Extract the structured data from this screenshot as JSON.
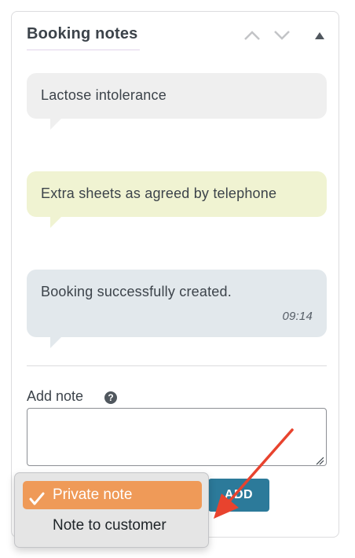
{
  "panel": {
    "title": "Booking notes",
    "header_buttons": [
      {
        "icon": "chevron-up-icon"
      },
      {
        "icon": "chevron-down-icon"
      },
      {
        "icon": "caret-up-icon"
      }
    ]
  },
  "notes": [
    {
      "text": "Lactose intolerance",
      "color": "#efefef"
    },
    {
      "text": "Extra sheets as agreed by telephone",
      "color": "#f0f3d2"
    },
    {
      "text": "Booking successfully created.",
      "time": "09:14",
      "color": "#e2e8ec"
    }
  ],
  "add_note": {
    "label": "Add note",
    "help_icon": "?",
    "input_value": "",
    "button_label": "ADD"
  },
  "note_type_menu": {
    "options": [
      {
        "label": "Private note",
        "selected": true
      },
      {
        "label": "Note to customer",
        "selected": false
      }
    ]
  },
  "colors": {
    "accent": "#2c7a9a",
    "selected_option": "#ef9a58",
    "annotation_arrow": "#e8432e"
  }
}
